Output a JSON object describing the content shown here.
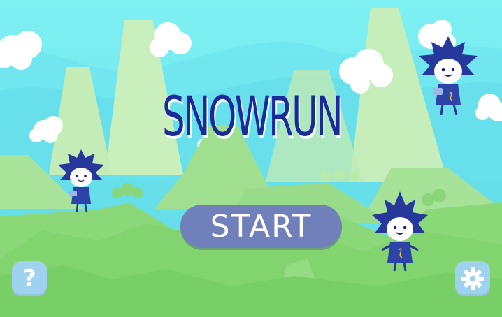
{
  "game": {
    "title": "SNOWRUN",
    "start_label": "START",
    "help_glyph": "?"
  },
  "icons": {
    "help": "question-mark-icon",
    "settings": "gear-icon"
  },
  "colors": {
    "sky": "#7ef0f2",
    "title_text": "#1a2a9a",
    "start_button": "#6f80ba",
    "icon_button": "#9fd2ef",
    "hill_front": "#86da74",
    "mountain_pale": "#c5eeb9",
    "character_blue": "#26389c"
  }
}
